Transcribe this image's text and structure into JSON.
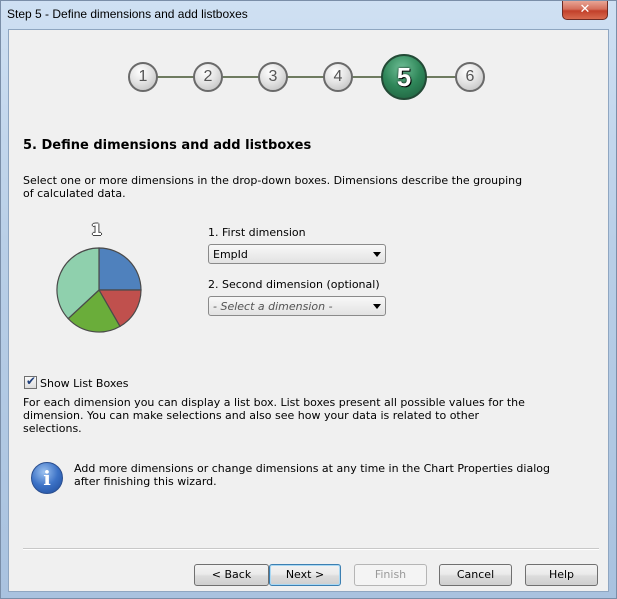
{
  "window": {
    "title": "Step 5 - Define dimensions and add listboxes",
    "close_glyph": "✕"
  },
  "steps": [
    {
      "label": "1",
      "active": false
    },
    {
      "label": "2",
      "active": false
    },
    {
      "label": "3",
      "active": false
    },
    {
      "label": "4",
      "active": false
    },
    {
      "label": "5",
      "active": true
    },
    {
      "label": "6",
      "active": false
    }
  ],
  "heading": "5. Define dimensions and add listboxes",
  "description": "Select one or more dimensions in the drop-down boxes. Dimensions describe the grouping of calculated data.",
  "pie": {
    "number": "1",
    "colors": {
      "blue": "#4f81bd",
      "red": "#c0504d",
      "green": "#6aad3a",
      "mint": "#8fd0ad",
      "outline": "#4a4a4a"
    }
  },
  "first_dimension": {
    "label": "1. First dimension",
    "value": "EmpId"
  },
  "second_dimension": {
    "label": "2. Second dimension (optional)",
    "placeholder": "- Select a dimension -"
  },
  "show_list_boxes": {
    "label": "Show List Boxes",
    "checked": true,
    "check_glyph": "✔"
  },
  "list_boxes_description": "For each dimension you can display a list box. List boxes present all possible values for the dimension. You can make selections and also see how your data is related to other selections.",
  "info": {
    "icon": "info-icon",
    "glyph": "i",
    "text": "Add more dimensions or change dimensions at any time in the Chart Properties dialog after finishing this wizard."
  },
  "buttons": {
    "back": "< Back",
    "next": "Next >",
    "finish": "Finish",
    "cancel": "Cancel",
    "help": "Help"
  }
}
